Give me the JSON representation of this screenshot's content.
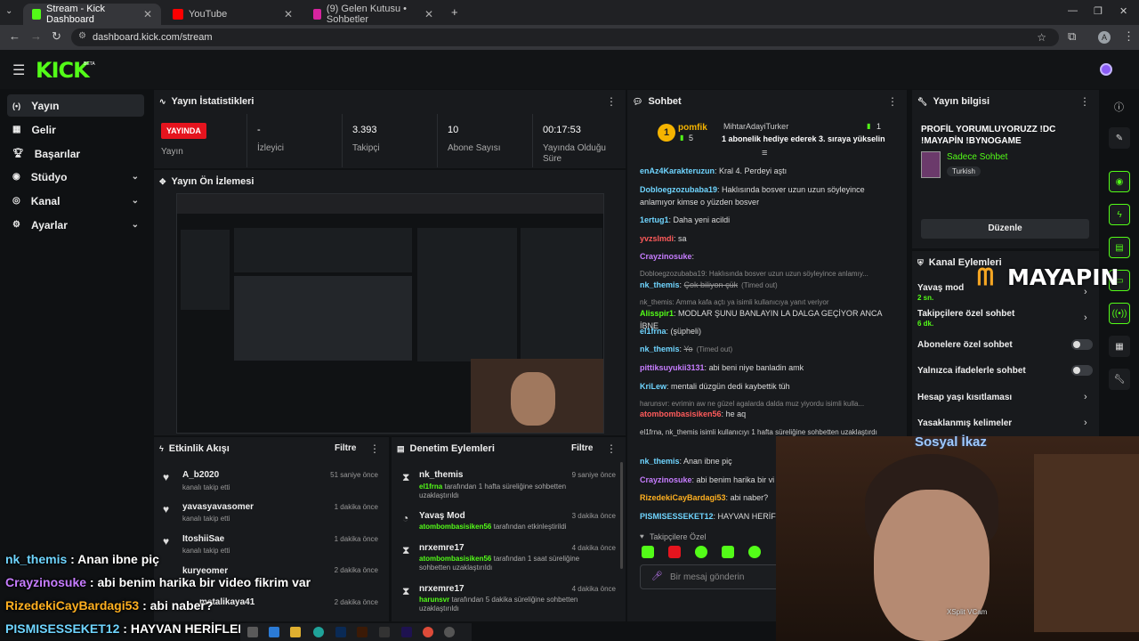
{
  "browser": {
    "tabs": [
      {
        "title": "Stream - Kick Dashboard"
      },
      {
        "title": "YouTube"
      },
      {
        "title": "(9) Gelen Kutusu • Sohbetler"
      }
    ],
    "url": "dashboard.kick.com/stream",
    "profile_initial": "A"
  },
  "brand": {
    "logo": "KICK",
    "beta": "BETA",
    "accent": "#53fc18"
  },
  "sidebar": {
    "items": [
      {
        "label": "Yayın"
      },
      {
        "label": "Gelir"
      },
      {
        "label": "Başarılar"
      },
      {
        "label": "Stüdyo"
      },
      {
        "label": "Kanal"
      },
      {
        "label": "Ayarlar"
      }
    ]
  },
  "stats": {
    "title": "Yayın İstatistikleri",
    "status": "YAYINDA",
    "status_label": "Yayın",
    "viewers_value": "-",
    "viewers_label": "İzleyici",
    "followers_value": "3.393",
    "followers_label": "Takipçi",
    "subs_value": "10",
    "subs_label": "Abone Sayısı",
    "uptime_value": "00:17:53",
    "uptime_label": "Yayında Olduğu Süre"
  },
  "preview": {
    "title": "Yayın Ön İzlemesi"
  },
  "activity": {
    "title": "Etkinlik Akışı",
    "filter": "Filtre",
    "items": [
      {
        "name": "A_b2020",
        "sub": "kanalı takip etti",
        "time": "51 saniye önce"
      },
      {
        "name": "yavasyavasomer",
        "sub": "kanalı takip etti",
        "time": "1 dakika önce"
      },
      {
        "name": "ItoshiiSae",
        "sub": "kanalı takip etti",
        "time": "1 dakika önce"
      },
      {
        "name": "kuryeomer",
        "sub": "",
        "time": "2 dakika önce"
      },
      {
        "name": "metalikaya41",
        "sub": "",
        "time": "2 dakika önce"
      }
    ]
  },
  "moderation": {
    "title": "Denetim Eylemleri",
    "filter": "Filtre",
    "items": [
      {
        "name": "nk_themis",
        "actor": "el1frna",
        "text": "tarafından 1 hafta süreliğine sohbetten uzaklaştırıldı",
        "time": "9 saniye önce"
      },
      {
        "name": "Yavaş Mod",
        "actor": "atombombasisiken56",
        "text": "tarafından etkinleştirildi",
        "time": "3 dakika önce"
      },
      {
        "name": "nrxemre17",
        "actor": "atombombasisiken56",
        "text": "tarafından 1 saat süreliğine sohbetten uzaklaştırıldı",
        "time": "4 dakika önce"
      },
      {
        "name": "nrxemre17",
        "actor": "harunsvr",
        "text": "tarafından 5 dakika süreliğine sohbetten uzaklaştırıldı",
        "time": "4 dakika önce"
      }
    ]
  },
  "chat": {
    "title": "Sohbet",
    "pinned": {
      "gifter": "pomfik",
      "gifter_count": "5",
      "receiver": "MihtarAdayiTurker",
      "receiver_count": "1",
      "text": "1 abonelik hediye ederek 3. sıraya yükselin",
      "rank": "1"
    },
    "messages": [
      {
        "user": "enAz4Karakteruzun",
        "color": "#6fd5ff",
        "text": "Kral 4. Perdeyi aştı"
      },
      {
        "user": "Dobloegzozubaba19",
        "color": "#6fd5ff",
        "text": "Haklısında bosver uzun uzun söyleyince anlamıyor kimse o yüzden bosver"
      },
      {
        "user": "1ertug1",
        "color": "#6fd5ff",
        "text": "Daha yeni acildi"
      },
      {
        "user": "yvzslmdi",
        "color": "#ff5b5b",
        "text": "sa"
      },
      {
        "user": "Crayzinosuke",
        "color": "#c77dff",
        "text": ""
      },
      {
        "user": "",
        "color": "#888",
        "text": "Dobloegzozubaba19: Haklısında bosver uzun uzun söyleyince anlamıy..."
      },
      {
        "user": "nk_themis",
        "color": "#6fd5ff",
        "text": "Çok biliyon çük",
        "note": "(Timed out)"
      },
      {
        "user": "",
        "color": "#888",
        "text": "nk_themis: Amma kafa açtı ya isimli kullanıcıya yanıt veriyor"
      },
      {
        "user": "Alisspir1",
        "color": "#53fc18",
        "text": "MODLAR ŞUNU BANLAYIN LA DALGA GEÇİYOR ANCA İBNE"
      },
      {
        "user": "el1frna",
        "color": "#6fd5ff",
        "text": "(şüpheli)"
      },
      {
        "user": "nk_themis",
        "color": "#6fd5ff",
        "text": "Yo",
        "note": "(Timed out)"
      },
      {
        "user": "pittiksuyukii3131",
        "color": "#c77dff",
        "text": "abi beni niye banladin amk"
      },
      {
        "user": "KriLew",
        "color": "#6fd5ff",
        "text": "mentali düzgün dedi kaybettik tüh"
      },
      {
        "user": "",
        "color": "#888",
        "text": "harunsvr: evrimin aw ne güzel agalarda dalda muz yiyordu isimli kulla..."
      },
      {
        "user": "atombombasisiken56",
        "color": "#ff5b5b",
        "text": "he aq"
      },
      {
        "user": "",
        "color": "#ccc",
        "text": "el1frna, nk_themis isimli kullanıcıyı 1 hafta süreliğine sohbetten uzaklaştırdı"
      },
      {
        "user": "nk_themis",
        "color": "#6fd5ff",
        "text": "Anan ibne piç"
      },
      {
        "user": "Crayzinosuke",
        "color": "#c77dff",
        "text": "abi benim harika bir vi"
      },
      {
        "user": "RizedekiCayBardagi53",
        "color": "#ffb020",
        "text": "abi naber?"
      },
      {
        "user": "PISMISESSEKET12",
        "color": "#6fd5ff",
        "text": "HAYVAN HERİFLE"
      }
    ],
    "followers_only": "Takipçilere Özel",
    "input_placeholder": "Bir mesaj gönderin"
  },
  "stream_info": {
    "title": "Yayın bilgisi",
    "stream_title": "PROFİL YORUMLUYORUZZ !DC !MAYAPİN !BYNOGAME",
    "category": "Sadece Sohbet",
    "tag": "Turkish",
    "edit_button": "Düzenle"
  },
  "channel_actions": {
    "title": "Kanal Eylemleri",
    "items": [
      {
        "label": "Yavaş mod",
        "sub": "2 sn.",
        "kind": "link"
      },
      {
        "label": "Takipçilere özel sohbet",
        "sub": "6 dk.",
        "kind": "link"
      },
      {
        "label": "Abonelere özel sohbet",
        "sub": "",
        "kind": "toggle"
      },
      {
        "label": "Yalnızca ifadelerle sohbet",
        "sub": "",
        "kind": "toggle"
      },
      {
        "label": "Hesap yaşı kısıtlaması",
        "sub": "",
        "kind": "link"
      },
      {
        "label": "Yasaklanmış kelimeler",
        "sub": "",
        "kind": "link"
      }
    ]
  },
  "overlay": {
    "sponsor": "MAYAPIN",
    "webcam_label": "Sosyal İkaz",
    "vcam": "XSplit VCam",
    "chat": [
      {
        "user": "nk_themis",
        "color": "#6fd5ff",
        "text": " : Anan ibne piç"
      },
      {
        "user": "Crayzinosuke",
        "color": "#c77dff",
        "text": " : abi benim harika bir video fikrim var"
      },
      {
        "user": "RizedekiCayBardagi53",
        "color": "#ffb020",
        "text": " : abi naber?"
      },
      {
        "user": "PISMISESSEKET12",
        "color": "#6fd5ff",
        "text": " : HAYVAN HERİFLER"
      }
    ]
  }
}
